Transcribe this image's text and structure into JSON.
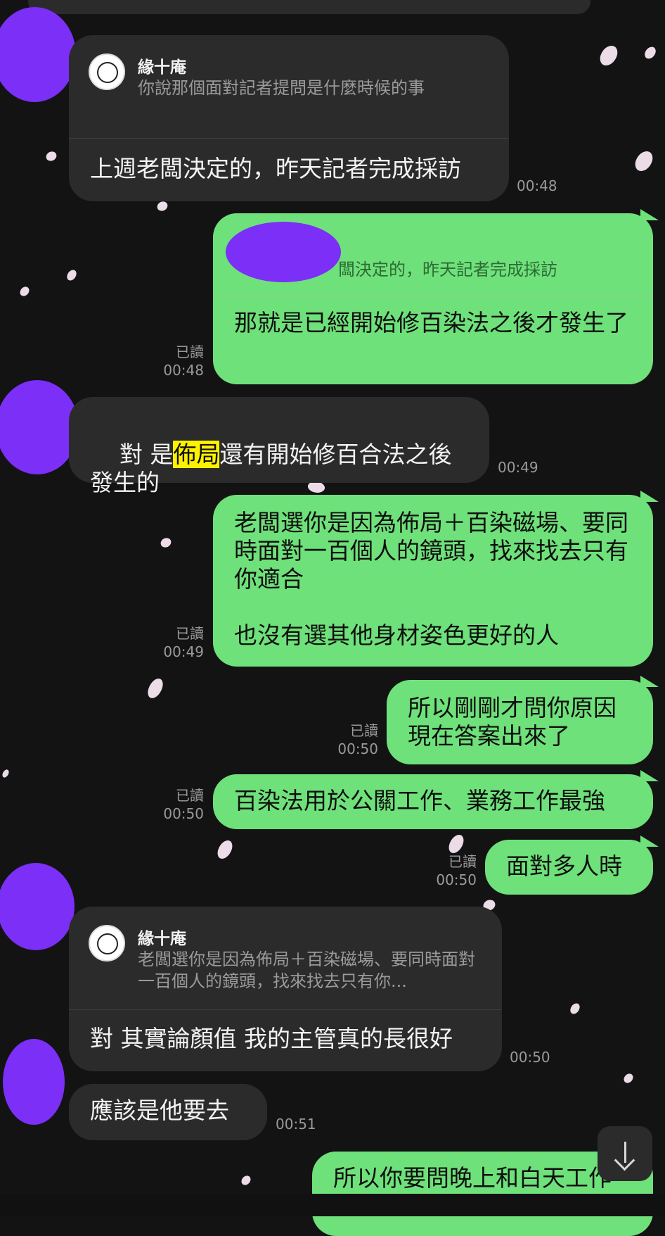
{
  "colors": {
    "background": "#131313",
    "incoming_bubble": "#2b2b2b",
    "outgoing_bubble": "#6ee17a",
    "avatar_redaction": "#7b2ff7",
    "highlight": "#fff200"
  },
  "messages": [
    {
      "quote_name": "緣十庵",
      "quote_preview": "你說那個面對記者提問是什麼時候的事",
      "text": "上週老闆決定的，昨天記者完成採訪",
      "time": "00:48"
    },
    {
      "quote_preview": "闆決定的，昨天記者完成採訪",
      "text": "那就是已經開始修百染法之後才發生了",
      "read": "已讀",
      "time": "00:48"
    },
    {
      "text_prefix": "對 是",
      "highlight": "佈局",
      "text_suffix": "還有開始修百合法之後發生的",
      "time": "00:49"
    },
    {
      "text": "老闆選你是因為佈局＋百染磁場、要同時面對一百個人的鏡頭，找來找去只有你適合\n\n也沒有選其他身材姿色更好的人",
      "read": "已讀",
      "time": "00:49"
    },
    {
      "text": "所以剛剛才問你原因\n現在答案出來了",
      "read": "已讀",
      "time": "00:50"
    },
    {
      "text": "百染法用於公關工作、業務工作最強",
      "read": "已讀",
      "time": "00:50"
    },
    {
      "text": "面對多人時",
      "read": "已讀",
      "time": "00:50"
    },
    {
      "quote_name": "緣十庵",
      "quote_preview": "老闆選你是因為佈局＋百染磁場、要同時面對一百個人的鏡頭，找來找去只有你...",
      "text": "對 其實論顏值 我的主管真的長很好",
      "time": "00:50"
    },
    {
      "text": "應該是他要去",
      "time": "00:51"
    },
    {
      "text": "所以你要問晚上和白天工作"
    }
  ],
  "icons": {
    "scroll_down": "arrow-down-icon"
  }
}
